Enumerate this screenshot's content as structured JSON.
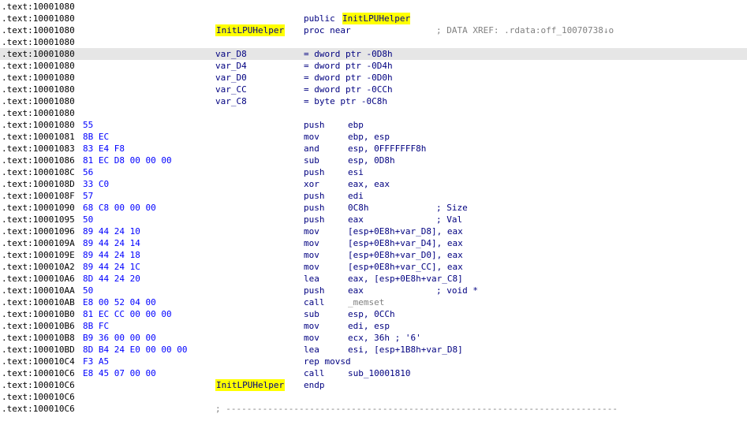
{
  "lines": [
    {
      "addr": ".text:10001080"
    },
    {
      "addr": ".text:10001080",
      "public_kw": "public",
      "public_name": "InitLPUHelper"
    },
    {
      "addr": ".text:10001080",
      "label": "InitLPUHelper",
      "proc": "proc near",
      "xref": "; DATA XREF: .rdata:off_10070738↓o"
    },
    {
      "addr": ".text:10001080"
    },
    {
      "addr": ".text:10001080",
      "label": "var_D8",
      "ops": "= dword ptr -0D8h"
    },
    {
      "addr": ".text:10001080",
      "label": "var_D4",
      "ops": "= dword ptr -0D4h"
    },
    {
      "addr": ".text:10001080",
      "label": "var_D0",
      "ops": "= dword ptr -0D0h"
    },
    {
      "addr": ".text:10001080",
      "label": "var_CC",
      "ops": "= dword ptr -0CCh"
    },
    {
      "addr": ".text:10001080",
      "label": "var_C8",
      "ops": "= byte ptr -0C8h"
    },
    {
      "addr": ".text:10001080"
    },
    {
      "addr": ".text:10001080",
      "bytes": "55",
      "mnem": "push",
      "ops": "ebp"
    },
    {
      "addr": ".text:10001081",
      "bytes": "8B EC",
      "mnem": "mov",
      "ops": "ebp, esp"
    },
    {
      "addr": ".text:10001083",
      "bytes": "83 E4 F8",
      "mnem": "and",
      "ops": "esp, 0FFFFFFF8h"
    },
    {
      "addr": ".text:10001086",
      "bytes": "81 EC D8 00 00 00",
      "mnem": "sub",
      "ops": "esp, 0D8h"
    },
    {
      "addr": ".text:1000108C",
      "bytes": "56",
      "mnem": "push",
      "ops": "esi"
    },
    {
      "addr": ".text:1000108D",
      "bytes": "33 C0",
      "mnem": "xor",
      "ops": "eax, eax"
    },
    {
      "addr": ".text:1000108F",
      "bytes": "57",
      "mnem": "push",
      "ops": "edi"
    },
    {
      "addr": ".text:10001090",
      "bytes": "68 C8 00 00 00",
      "mnem": "push",
      "ops": "0C8h",
      "cmt": "; Size"
    },
    {
      "addr": ".text:10001095",
      "bytes": "50",
      "mnem": "push",
      "ops": "eax",
      "cmt": "; Val"
    },
    {
      "addr": ".text:10001096",
      "bytes": "89 44 24 10",
      "mnem": "mov",
      "ops": "[esp+0E8h+var_D8], eax"
    },
    {
      "addr": ".text:1000109A",
      "bytes": "89 44 24 14",
      "mnem": "mov",
      "ops": "[esp+0E8h+var_D4], eax"
    },
    {
      "addr": ".text:1000109E",
      "bytes": "89 44 24 18",
      "mnem": "mov",
      "ops": "[esp+0E8h+var_D0], eax"
    },
    {
      "addr": ".text:100010A2",
      "bytes": "89 44 24 1C",
      "mnem": "mov",
      "ops": "[esp+0E8h+var_CC], eax"
    },
    {
      "addr": ".text:100010A6",
      "bytes": "8D 44 24 20",
      "mnem": "lea",
      "ops": "eax, [esp+0E8h+var_C8]"
    },
    {
      "addr": ".text:100010AA",
      "bytes": "50",
      "mnem": "push",
      "ops": "eax",
      "cmt": "; void *"
    },
    {
      "addr": ".text:100010AB",
      "bytes": "E8 00 52 04 00",
      "mnem": "call",
      "ops": "_memset",
      "ops_style": "funcref"
    },
    {
      "addr": ".text:100010B0",
      "bytes": "81 EC CC 00 00 00",
      "mnem": "sub",
      "ops": "esp, 0CCh"
    },
    {
      "addr": ".text:100010B6",
      "bytes": "8B FC",
      "mnem": "mov",
      "ops": "edi, esp"
    },
    {
      "addr": ".text:100010B8",
      "bytes": "B9 36 00 00 00",
      "mnem": "mov",
      "ops": "ecx, 36h ; '6'"
    },
    {
      "addr": ".text:100010BD",
      "bytes": "8D B4 24 E0 00 00 00",
      "mnem": "lea",
      "ops": "esi, [esp+1B8h+var_D8]"
    },
    {
      "addr": ".text:100010C4",
      "bytes": "F3 A5",
      "mnem": "rep movsd"
    },
    {
      "addr": ".text:100010C6",
      "bytes": "E8 45 07 00 00",
      "mnem": "call",
      "ops": "sub_10001810"
    },
    {
      "addr": ".text:100010C6",
      "label": "InitLPUHelper",
      "proc": "endp"
    },
    {
      "addr": ".text:100010C6"
    },
    {
      "addr": ".text:100010C6",
      "separator": "; ---------------------------------------------------------------------------"
    }
  ],
  "highlight_color": "#ffff00",
  "current_line_color": "#e6e6e6"
}
